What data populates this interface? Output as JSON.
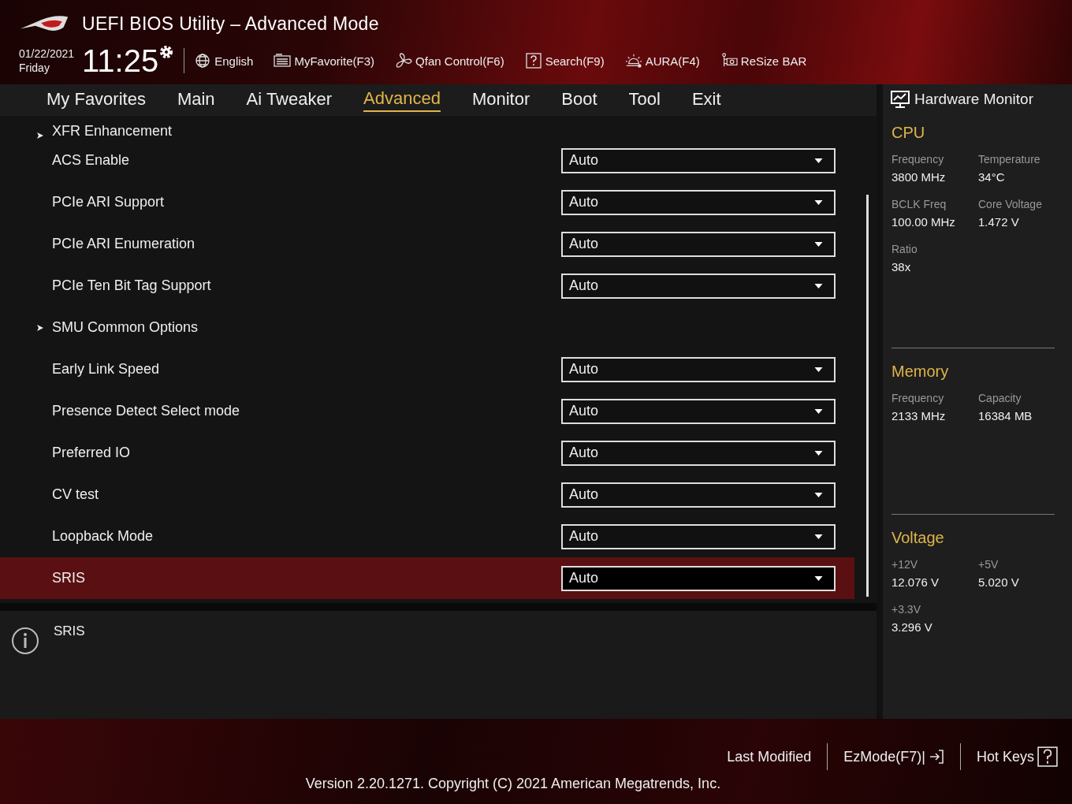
{
  "header": {
    "title": "UEFI BIOS Utility – Advanced Mode",
    "date": "01/22/2021",
    "day": "Friday",
    "time": "11:25",
    "tools": [
      {
        "kind": "globe",
        "label": "English"
      },
      {
        "kind": "favorite",
        "label": "MyFavorite(F3)"
      },
      {
        "kind": "fan",
        "label": "Qfan Control(F6)"
      },
      {
        "kind": "search",
        "label": "Search(F9)"
      },
      {
        "kind": "aura",
        "label": "AURA(F4)"
      },
      {
        "kind": "resize",
        "label": "ReSize BAR"
      }
    ]
  },
  "tabs": [
    {
      "label": "My Favorites",
      "selected": false
    },
    {
      "label": "Main",
      "selected": false
    },
    {
      "label": "Ai Tweaker",
      "selected": false
    },
    {
      "label": "Advanced",
      "selected": true
    },
    {
      "label": "Monitor",
      "selected": false
    },
    {
      "label": "Boot",
      "selected": false
    },
    {
      "label": "Tool",
      "selected": false
    },
    {
      "label": "Exit",
      "selected": false
    }
  ],
  "settings": [
    {
      "kind": "submenu",
      "label": "XFR Enhancement",
      "selected": false
    },
    {
      "kind": "dropdown",
      "label": "ACS Enable",
      "value": "Auto",
      "selected": false
    },
    {
      "kind": "dropdown",
      "label": "PCIe ARI Support",
      "value": "Auto",
      "selected": false
    },
    {
      "kind": "dropdown",
      "label": "PCIe ARI Enumeration",
      "value": "Auto",
      "selected": false
    },
    {
      "kind": "dropdown",
      "label": "PCIe Ten Bit Tag Support",
      "value": "Auto",
      "selected": false
    },
    {
      "kind": "submenu",
      "label": "SMU Common Options",
      "selected": false
    },
    {
      "kind": "dropdown",
      "label": "Early Link Speed",
      "value": "Auto",
      "selected": false
    },
    {
      "kind": "dropdown",
      "label": "Presence Detect Select mode",
      "value": "Auto",
      "selected": false
    },
    {
      "kind": "dropdown",
      "label": "Preferred IO",
      "value": "Auto",
      "selected": false
    },
    {
      "kind": "dropdown",
      "label": "CV test",
      "value": "Auto",
      "selected": false
    },
    {
      "kind": "dropdown",
      "label": "Loopback Mode",
      "value": "Auto",
      "selected": false
    },
    {
      "kind": "dropdown",
      "label": "SRIS",
      "value": "Auto",
      "selected": true
    }
  ],
  "info": {
    "text": "SRIS"
  },
  "hardware_monitor": {
    "title": "Hardware Monitor",
    "sections": [
      {
        "title": "CPU",
        "items": [
          {
            "label": "Frequency",
            "value": "3800 MHz"
          },
          {
            "label": "Temperature",
            "value": "34°C"
          },
          {
            "label": "BCLK Freq",
            "value": "100.00 MHz"
          },
          {
            "label": "Core Voltage",
            "value": "1.472 V"
          },
          {
            "label": "Ratio",
            "value": "38x"
          }
        ]
      },
      {
        "title": "Memory",
        "items": [
          {
            "label": "Frequency",
            "value": "2133 MHz"
          },
          {
            "label": "Capacity",
            "value": "16384 MB"
          }
        ]
      },
      {
        "title": "Voltage",
        "items": [
          {
            "label": "+12V",
            "value": "12.076 V"
          },
          {
            "label": "+5V",
            "value": "5.020 V"
          },
          {
            "label": "+3.3V",
            "value": "3.296 V"
          }
        ]
      }
    ]
  },
  "footer": {
    "last_modified": "Last Modified",
    "ezmode": "EzMode(F7)|",
    "hot_keys": "Hot Keys",
    "version": "Version 2.20.1271. Copyright (C) 2021 American Megatrends, Inc."
  }
}
